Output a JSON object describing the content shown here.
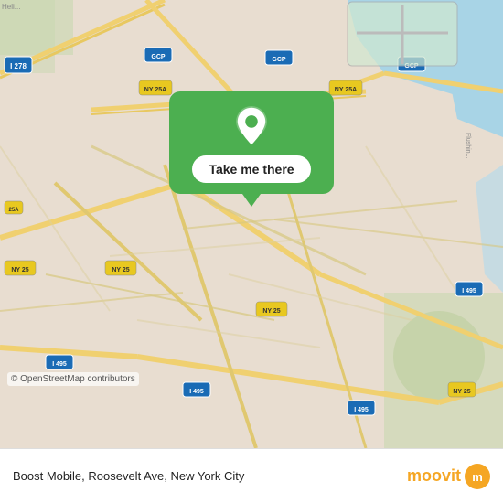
{
  "map": {
    "background_color": "#e8ddd0",
    "copyright": "© OpenStreetMap contributors"
  },
  "popup": {
    "button_label": "Take me there",
    "background_color": "#4CAF50"
  },
  "bottom_bar": {
    "location_text": "Boost Mobile, Roosevelt Ave, New York City",
    "moovit_label": "moovit",
    "moovit_icon_label": "m"
  }
}
